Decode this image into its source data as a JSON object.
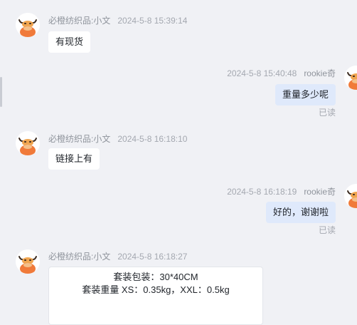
{
  "messages": [
    {
      "sender": "必橙纺织品:小文",
      "time": "2024-5-8 15:39:14",
      "text": "有现货"
    },
    {
      "sender": "rookie奇",
      "time": "2024-5-8 15:40:48",
      "text": "重量多少呢",
      "status": "已读"
    },
    {
      "sender": "必橙纺织品:小文",
      "time": "2024-5-8 16:18:10",
      "text": "链接上有"
    },
    {
      "sender": "rookie奇",
      "time": "2024-5-8 16:18:19",
      "text": "好的，谢谢啦",
      "status": "已读"
    },
    {
      "sender": "必橙纺织品:小文",
      "time": "2024-5-8 16:18:27",
      "lines": [
        "套装包装：30*40CM",
        "套装重量 XS：0.35kg，XXL：0.5kg"
      ]
    }
  ],
  "icons": {
    "seller_avatar": "bull-avatar-icon",
    "buyer_avatar": "bull-avatar-icon"
  },
  "colors": {
    "background": "#f0f1f5",
    "incoming_bubble": "#ffffff",
    "outgoing_bubble": "#dfe9fb",
    "avatar_orange": "#f07a3a"
  }
}
